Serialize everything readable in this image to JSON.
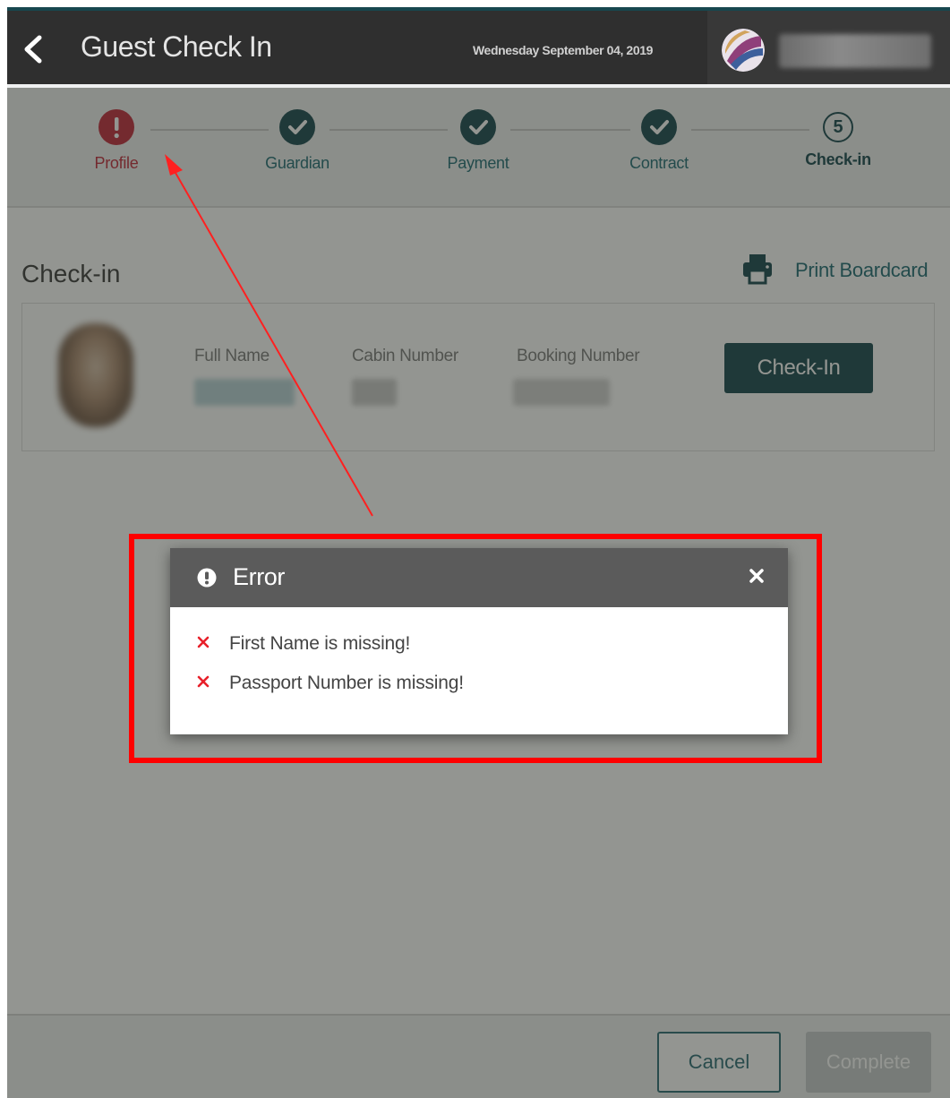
{
  "header": {
    "title": "Guest Check In",
    "date": "Wednesday September 04, 2019"
  },
  "stepper": {
    "steps": [
      {
        "label": "Profile",
        "state": "error"
      },
      {
        "label": "Guardian",
        "state": "done"
      },
      {
        "label": "Payment",
        "state": "done"
      },
      {
        "label": "Contract",
        "state": "done"
      },
      {
        "label": "Check-in",
        "state": "current",
        "number": "5"
      }
    ]
  },
  "checkin": {
    "section_title": "Check-in",
    "print_label": "Print Boardcard",
    "columns": {
      "full_name": "Full Name",
      "cabin_number": "Cabin Number",
      "booking_number": "Booking Number"
    },
    "checkin_button": "Check-In"
  },
  "footer": {
    "cancel_label": "Cancel",
    "complete_label": "Complete"
  },
  "dialog": {
    "title": "Error",
    "errors": [
      "First Name is missing!",
      "Passport Number is missing!"
    ]
  },
  "colors": {
    "primary": "#17474f",
    "link": "#1e6b74",
    "error": "#c0283a",
    "annotation": "#ff0000"
  }
}
